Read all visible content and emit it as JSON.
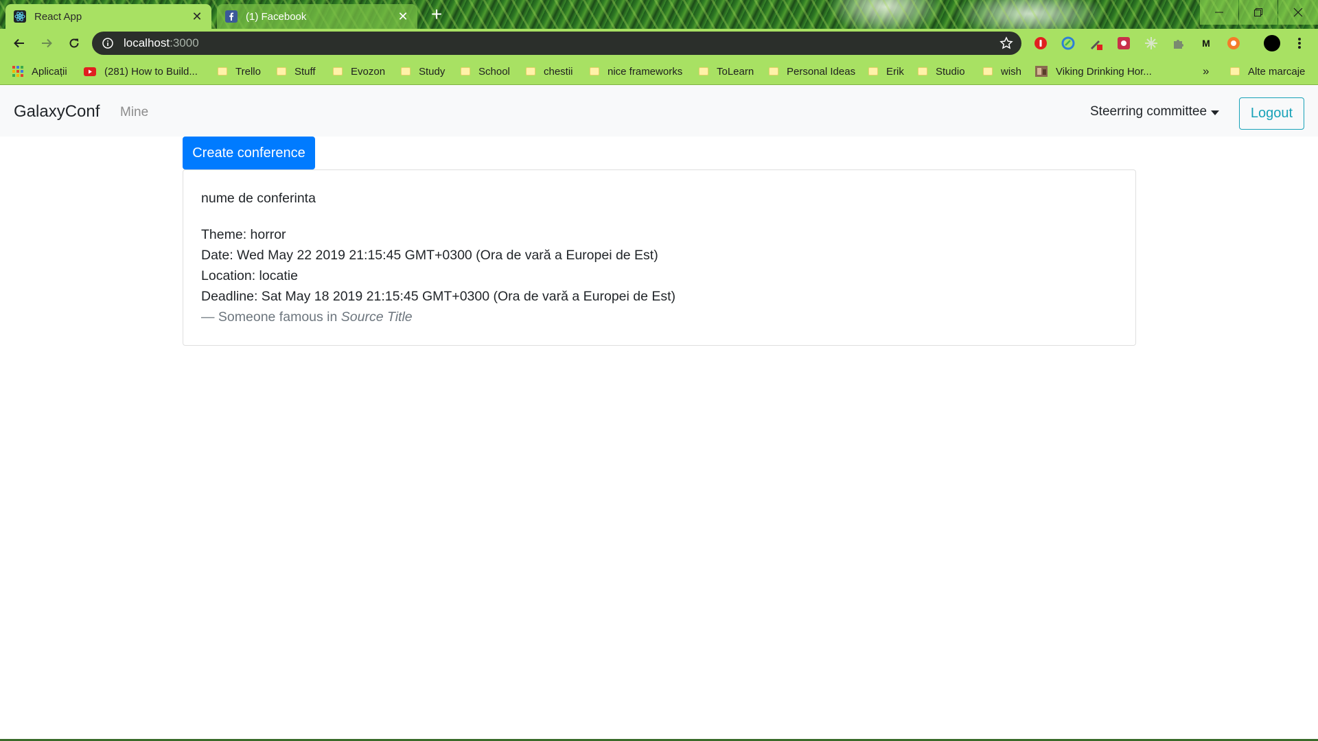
{
  "browser": {
    "tabs": [
      {
        "title": "React App",
        "favicon": "react-icon",
        "active": true
      },
      {
        "title": "(1) Facebook",
        "favicon": "facebook-icon",
        "active": false
      }
    ],
    "new_tab_label": "+",
    "close_glyph": "✕",
    "address": {
      "host": "localhost",
      "port": ":3000"
    },
    "window_controls": [
      "minimize",
      "restore",
      "close"
    ],
    "extensions": [
      "adblock-icon",
      "sync-icon",
      "pen-icon",
      "game-icon",
      "sparkle-icon",
      "puzzle-icon",
      "m-icon",
      "orange-circle-icon"
    ],
    "ext_m_label": "M"
  },
  "bookmarks": {
    "apps_label": "Aplicații",
    "items": [
      {
        "label": "(281) How to Build...",
        "icon": "youtube-icon"
      },
      {
        "label": "Trello",
        "icon": "folder-icon"
      },
      {
        "label": "Stuff",
        "icon": "folder-icon"
      },
      {
        "label": "Evozon",
        "icon": "folder-icon"
      },
      {
        "label": "Study",
        "icon": "folder-icon"
      },
      {
        "label": "School",
        "icon": "folder-icon"
      },
      {
        "label": "chestii",
        "icon": "folder-icon"
      },
      {
        "label": "nice frameworks",
        "icon": "folder-icon"
      },
      {
        "label": "ToLearn",
        "icon": "folder-icon"
      },
      {
        "label": "Personal Ideas",
        "icon": "folder-icon"
      },
      {
        "label": "Erik",
        "icon": "folder-icon"
      },
      {
        "label": "Studio",
        "icon": "folder-icon"
      },
      {
        "label": "wish",
        "icon": "folder-icon"
      },
      {
        "label": "Viking Drinking Hor...",
        "icon": "image-icon"
      }
    ],
    "overflow_label": "»",
    "other_label": "Alte marcaje"
  },
  "navbar": {
    "brand": "GalaxyConf",
    "link": "Mine",
    "dropdown": "Steerring committee",
    "logout": "Logout"
  },
  "main": {
    "create_button": "Create conference",
    "conference": {
      "name": "nume de conferinta",
      "theme": "Theme: horror",
      "date": "Date: Wed May 22 2019 21:15:45 GMT+0300 (Ora de vară a Europei de Est)",
      "location": "Location: locatie",
      "deadline": "Deadline: Sat May 18 2019 21:15:45 GMT+0300 (Ora de vară a Europei de Est)",
      "footer_prefix": "— Someone famous in ",
      "footer_source": "Source Title"
    }
  },
  "colors": {
    "primary": "#007bff",
    "info": "#17a2b8",
    "chrome_bar": "#a8e163"
  }
}
